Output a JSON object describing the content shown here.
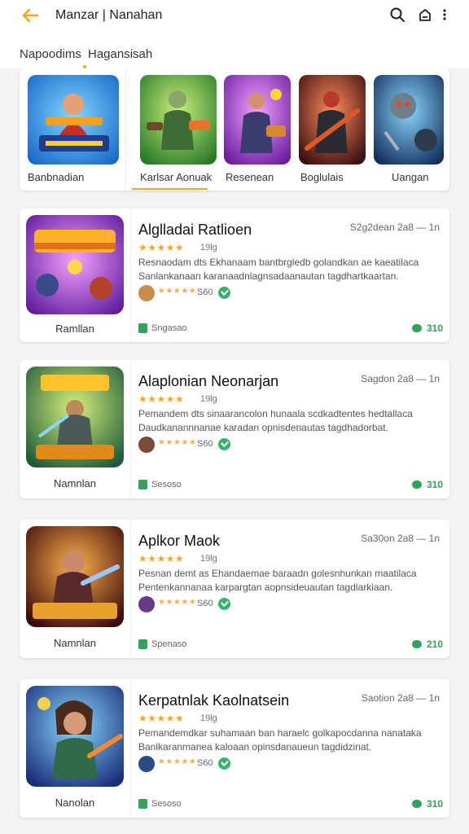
{
  "header": {
    "title": "Manzar | Nanahan",
    "back_icon": "back-arrow-icon",
    "search_icon": "search-icon",
    "share_icon": "share-icon",
    "more_icon": "more-vertical-icon",
    "accent_color": "#f5a623"
  },
  "tabs": [
    {
      "label": "Napoodims"
    },
    {
      "label": "Hagansisah"
    }
  ],
  "featured": [
    {
      "label": "Banbnadian"
    },
    {
      "label": "Karlsar Aonuak"
    },
    {
      "label": "Resenean"
    },
    {
      "label": "Boglulais"
    },
    {
      "label": "Uangan"
    }
  ],
  "cards": [
    {
      "title": "Alglladai Ratlioen",
      "date": "S2g2dean 2a8 — 1n",
      "stars": "★★★★★",
      "rating": "19lg",
      "desc": "Resnaodam dts  Ekhanaam bantbrgledb golandkan ae kaeatilaca Sanlankanaan karanaadnlagnsadaanautan tagdhartkaartan.",
      "thumb_label": "Ramllan",
      "mini_stars": "★★★★★",
      "meta_num": "S60",
      "footer_left": "Sngasao",
      "footer_right": "310"
    },
    {
      "title": "Alaplonian Neonarjan",
      "date": "Sagdon 2a8 — 1n",
      "stars": "★★★★★",
      "rating": "19lg",
      "desc": "Pemandem dts  sinaarancolon hunaala scdkadtentes hedtallaca Daudkanannnanae karadan opnisdenautas tagdhadorbat.",
      "thumb_label": "Namnlan",
      "mini_stars": "★★★★★",
      "meta_num": "S60",
      "footer_left": "Sesoso",
      "footer_right": "310"
    },
    {
      "title": "Aplkor Maok",
      "date": "Sa30on 2a8 — 1n",
      "stars": "★★★★★",
      "rating": "19lg",
      "desc": "Pesnan demt as  Ehandaemae baraadn golesnhunkan maatilaca Pentenkannanaa karpargtan aopnsideuautan tagdlarkiaan.",
      "thumb_label": "Namnlan",
      "mini_stars": "★★★★★",
      "meta_num": "S60",
      "footer_left": "Spenaso",
      "footer_right": "210"
    },
    {
      "title": "Kerpatnlak Kaolnatsein",
      "date": "Saotion 2a8 — 1n",
      "stars": "★★★★★",
      "rating": "19lg",
      "desc": "Pemandemdkar suhamaan ban haraelc golkapocdanna nanataka Banlkaranmanea kaloaan opinsdanaueun tagdidzinat.",
      "thumb_label": "Nanolan",
      "mini_stars": "★★★★★",
      "meta_num": "S60",
      "footer_left": "Sesoso",
      "footer_right": "310"
    }
  ]
}
